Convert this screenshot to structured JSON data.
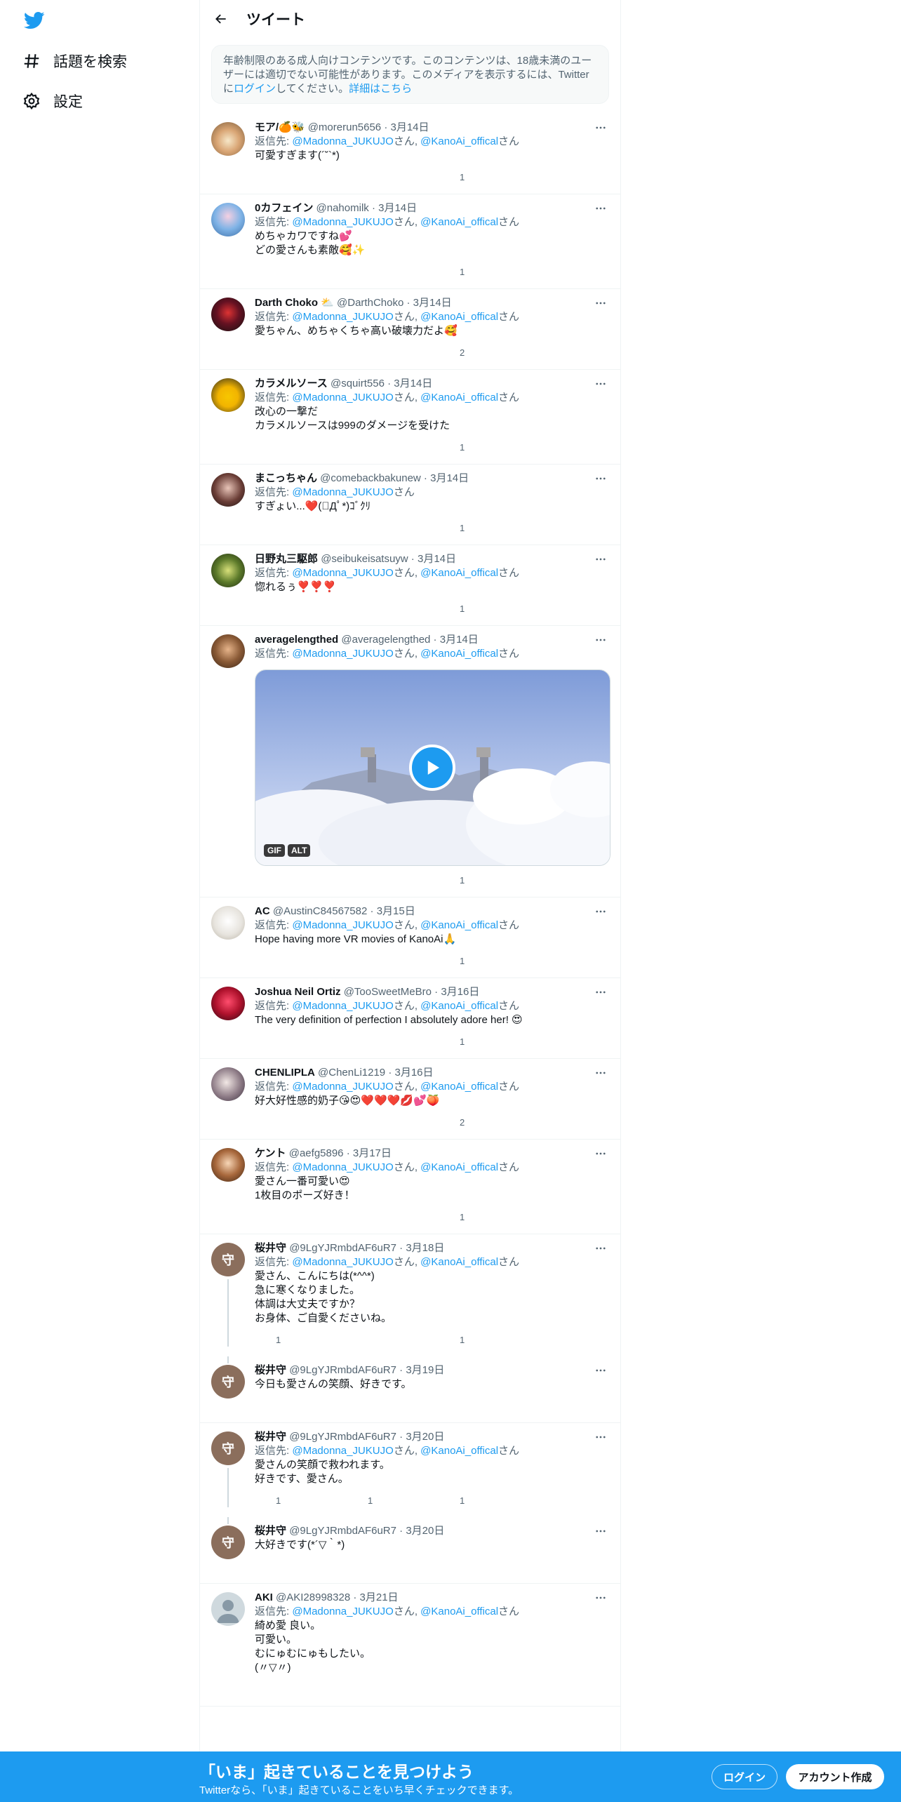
{
  "sidebar": {
    "logo": "twitter-bird-icon",
    "items": [
      {
        "label": "話題を検索",
        "icon": "hashtag-icon"
      },
      {
        "label": "設定",
        "icon": "gear-icon"
      }
    ]
  },
  "header": {
    "title": "ツイート"
  },
  "notice": {
    "text1": "年齢制限のある成人向けコンテンツです。このコンテンツは、18歳未満のユーザーには適切でない可能性があります。このメディアを表示するには、Twitterに",
    "login_link": "ログイン",
    "text2": "してください。",
    "details_link": "詳細はこちら"
  },
  "labels": {
    "replying_to": "返信先: ",
    "san": "さん",
    "comma": ", ",
    "and": "、"
  },
  "tweets": [
    {
      "name": "モア/🍊🐝",
      "handle": "@morerun5656",
      "date": "3月14日",
      "reply": [
        "@Madonna_JUKUJO",
        "@KanoAi_offical"
      ],
      "text": "可愛すぎます(´˘`*)",
      "replies": "",
      "retweets": "",
      "likes": "1"
    },
    {
      "name": "0カフェイン",
      "handle": "@nahomilk",
      "date": "3月14日",
      "reply": [
        "@Madonna_JUKUJO",
        "@KanoAi_offical"
      ],
      "text": "めちゃカワですね💕\nどの愛さんも素敵🥰✨",
      "replies": "",
      "retweets": "",
      "likes": "1"
    },
    {
      "name": "Darth Choko ⛅",
      "handle": "@DarthChoko",
      "date": "3月14日",
      "reply": [
        "@Madonna_JUKUJO",
        "@KanoAi_offical"
      ],
      "text": "愛ちゃん、めちゃくちゃ高い破壊力だよ🥰",
      "replies": "",
      "retweets": "",
      "likes": "2"
    },
    {
      "name": "カラメルソース",
      "handle": "@squirt556",
      "date": "3月14日",
      "reply": [
        "@Madonna_JUKUJO",
        "@KanoAi_offical"
      ],
      "text": "改心の一撃だ\nカラメルソースは999のダメージを受けた",
      "replies": "",
      "retweets": "",
      "likes": "1"
    },
    {
      "name": "まこっちゃん",
      "handle": "@comebackbakunew",
      "date": "3月14日",
      "reply": [
        "@Madonna_JUKUJO"
      ],
      "text": "すぎょい...❤️(ﾟДﾟ*)ｺﾞｸﾘ",
      "replies": "",
      "retweets": "",
      "likes": "1"
    },
    {
      "name": "日野丸三駆郎",
      "handle": "@seibukeisatsuyw",
      "date": "3月14日",
      "reply": [
        "@Madonna_JUKUJO",
        "@KanoAi_offical"
      ],
      "text": "惚れるぅ❣️❣️❣️",
      "replies": "",
      "retweets": "",
      "likes": "1"
    },
    {
      "name": "averagelengthed",
      "handle": "@averagelengthed",
      "date": "3月14日",
      "reply": [
        "@Madonna_JUKUJO",
        "@KanoAi_offical"
      ],
      "text": "",
      "media": {
        "gif": "GIF",
        "alt": "ALT"
      },
      "replies": "",
      "retweets": "",
      "likes": "1"
    },
    {
      "name": "AC",
      "handle": "@AustinC84567582",
      "date": "3月15日",
      "reply": [
        "@Madonna_JUKUJO",
        "@KanoAi_offical"
      ],
      "text": "Hope having more VR movies of KanoAi🙏",
      "replies": "",
      "retweets": "",
      "likes": "1"
    },
    {
      "name": "Joshua Neil Ortiz",
      "handle": "@TooSweetMeBro",
      "date": "3月16日",
      "reply": [
        "@Madonna_JUKUJO",
        "@KanoAi_offical"
      ],
      "text": "The very definition of perfection I absolutely adore her! 😍",
      "replies": "",
      "retweets": "",
      "likes": "1"
    },
    {
      "name": "CHENLIPLA",
      "handle": "@ChenLi1219",
      "date": "3月16日",
      "reply": [
        "@Madonna_JUKUJO",
        "@KanoAi_offical"
      ],
      "text": "好大好性感的奶子😘😍❤️❤️❤️💋💕🍑",
      "replies": "",
      "retweets": "",
      "likes": "2"
    },
    {
      "name": "ケント",
      "handle": "@aefg5896",
      "date": "3月17日",
      "reply": [
        "@Madonna_JUKUJO",
        "@KanoAi_offical"
      ],
      "text": "愛さん一番可愛い😍\n1枚目のポーズ好き！",
      "replies": "",
      "retweets": "",
      "likes": "1"
    },
    {
      "name": "桜井守",
      "handle": "@9LgYJRmbdAF6uR7",
      "date": "3月18日",
      "reply": [
        "@Madonna_JUKUJO",
        "@KanoAi_offical"
      ],
      "text": "愛さん、こんにちは(*^^*)\n急に寒くなりました。\n体調は大丈夫ですか？\nお身体、ご自愛くださいね。",
      "replies": "1",
      "retweets": "",
      "likes": "1",
      "avatar_char": "守"
    },
    {
      "name": "桜井守",
      "handle": "@9LgYJRmbdAF6uR7",
      "date": "3月19日",
      "reply": [],
      "text": "今日も愛さんの笑顔、好きです。",
      "replies": "",
      "retweets": "",
      "likes": "",
      "avatar_char": "守"
    },
    {
      "name": "桜井守",
      "handle": "@9LgYJRmbdAF6uR7",
      "date": "3月20日",
      "reply": [
        "@Madonna_JUKUJO",
        "@KanoAi_offical"
      ],
      "text": "愛さんの笑顔で救われます。\n好きです、愛さん。",
      "replies": "1",
      "retweets": "1",
      "likes": "1",
      "avatar_char": "守"
    },
    {
      "name": "桜井守",
      "handle": "@9LgYJRmbdAF6uR7",
      "date": "3月20日",
      "reply": [],
      "text": "大好きです(*´▽｀*)",
      "replies": "",
      "retweets": "",
      "likes": "",
      "avatar_char": "守"
    },
    {
      "name": "AKI",
      "handle": "@AKI28998328",
      "date": "3月21日",
      "reply": [
        "@Madonna_JUKUJO",
        "@KanoAi_offical"
      ],
      "text": "綺め愛 良い。\n可愛い。\nむにゅむにゅもしたい。\n(〃▽〃)",
      "replies": "",
      "retweets": "",
      "likes": ""
    }
  ],
  "colors": {
    "accent": "#1d9bf0",
    "muted": "#536471",
    "text": "#0f1419"
  },
  "banner": {
    "headline": "「いま」起きていることを見つけよう",
    "sub": "Twitterなら、「いま」起きていることをいち早くチェックできます。",
    "login": "ログイン",
    "signup": "アカウント作成"
  }
}
